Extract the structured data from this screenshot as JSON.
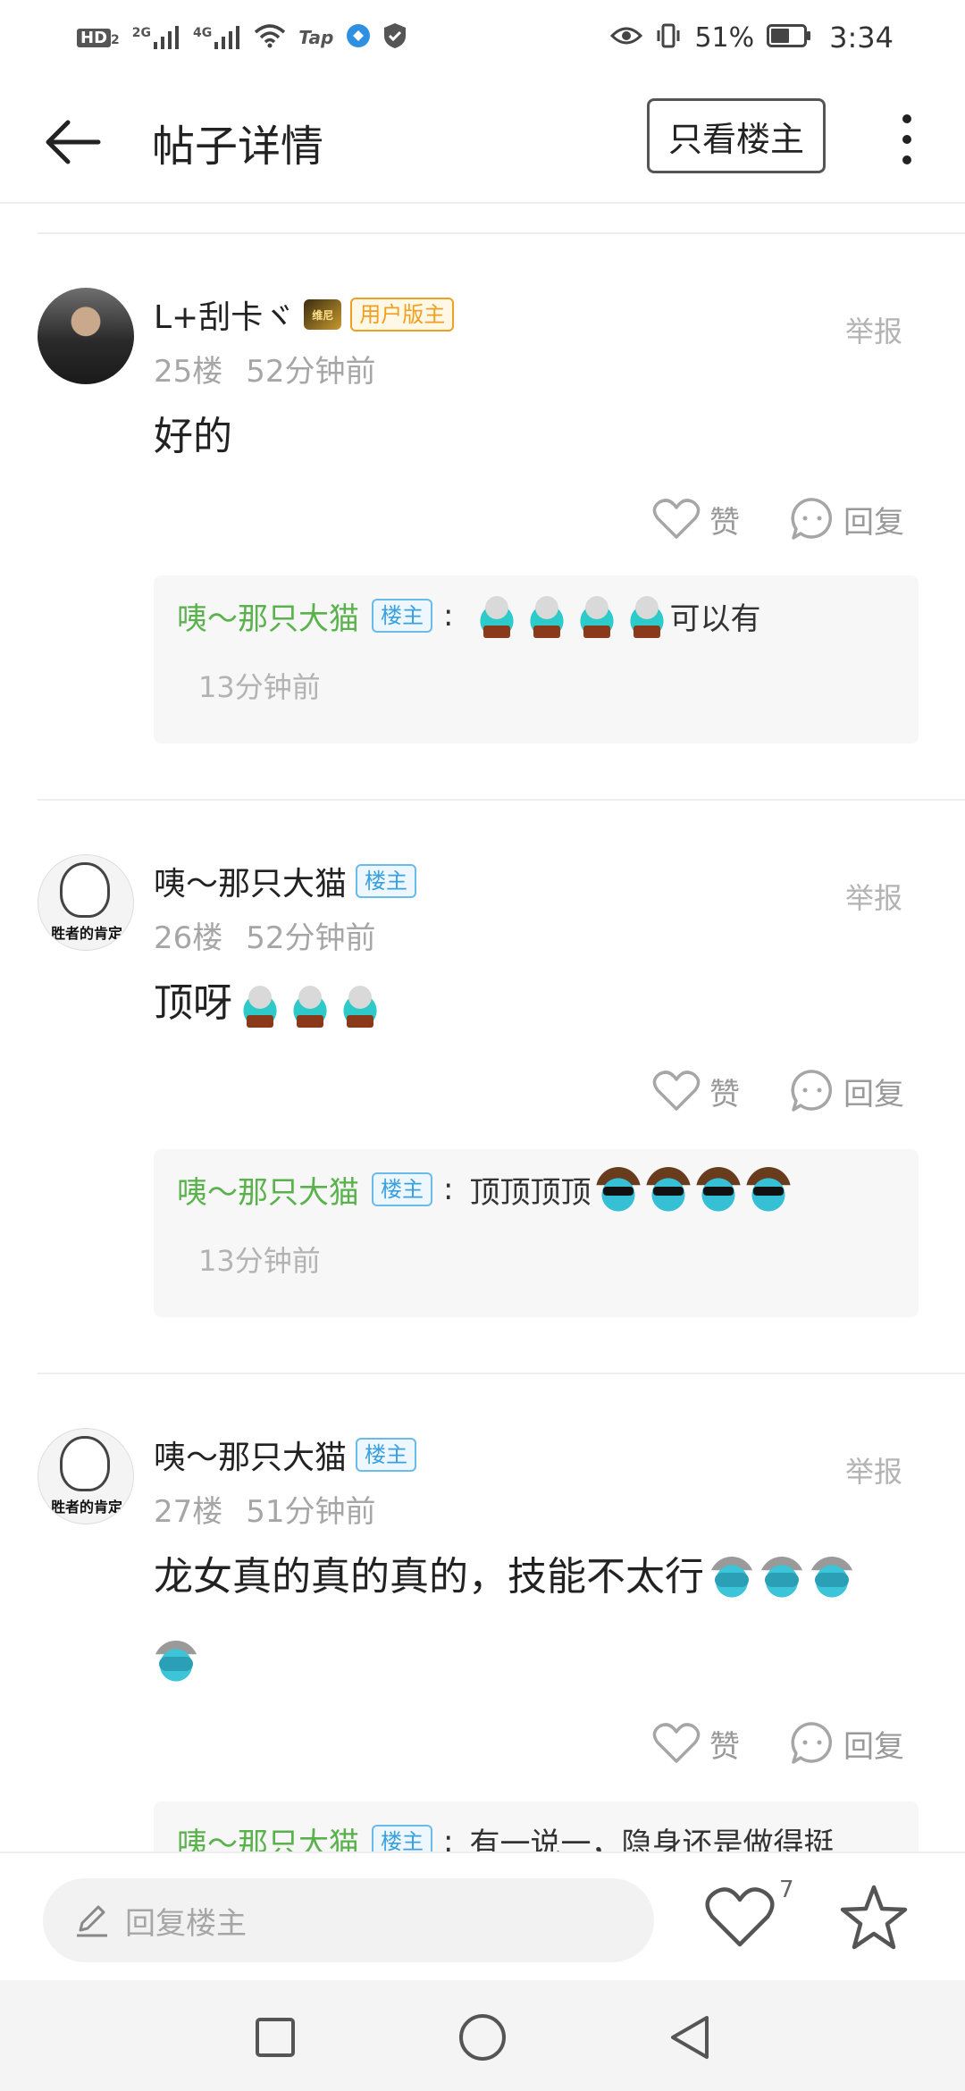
{
  "status_bar": {
    "left_icons": [
      "hd-icon",
      "signal-2g-icon",
      "signal-4g-icon",
      "wifi-icon",
      "tap-icon",
      "app-icon",
      "shield-icon"
    ],
    "hd_label": "HD",
    "hd_sub": "2",
    "net1": "2G",
    "net2": "4G",
    "tap_label": "Tap",
    "battery_percent": "51%",
    "time": "3:34"
  },
  "header": {
    "title": "帖子详情",
    "only_owner_label": "只看楼主"
  },
  "labels": {
    "report": "举报",
    "like": "赞",
    "reply": "回复"
  },
  "comments": [
    {
      "username": "L+刮卡ヾ",
      "level_badge": "维尼",
      "tag": "用户版主",
      "floor": "25楼",
      "time": "52分钟前",
      "text": "好的",
      "emojis": [],
      "reply": {
        "author": "咦～那只大猫",
        "tag": "楼主",
        "text": "可以有",
        "emojis": [
          "elf",
          "elf",
          "elf",
          "elf"
        ],
        "time": "13分钟前"
      }
    },
    {
      "username": "咦～那只大猫",
      "tag": "楼主",
      "avatar_caption": "胜者的肯定",
      "floor": "26楼",
      "time": "52分钟前",
      "text": "顶呀",
      "emojis": [
        "elf",
        "elf",
        "elf"
      ],
      "reply": {
        "author": "咦～那只大猫",
        "tag": "楼主",
        "text": "顶顶顶顶",
        "emojis": [
          "shades",
          "shades",
          "shades",
          "shades"
        ],
        "time": "13分钟前"
      }
    },
    {
      "username": "咦～那只大猫",
      "tag": "楼主",
      "avatar_caption": "胜者的肯定",
      "floor": "27楼",
      "time": "51分钟前",
      "text": "龙女真的真的真的，技能不太行",
      "emojis": [
        "facepalm",
        "facepalm",
        "facepalm",
        "facepalm"
      ],
      "reply": {
        "author": "咦～那只大猫",
        "tag": "楼主",
        "text": "有一说一，隐身还是做得挺"
      }
    }
  ],
  "bottom_bar": {
    "reply_placeholder": "回复楼主",
    "like_count": "7"
  },
  "nav_bar": {
    "buttons": [
      "recent-apps-button",
      "home-button",
      "back-nav-button"
    ]
  }
}
